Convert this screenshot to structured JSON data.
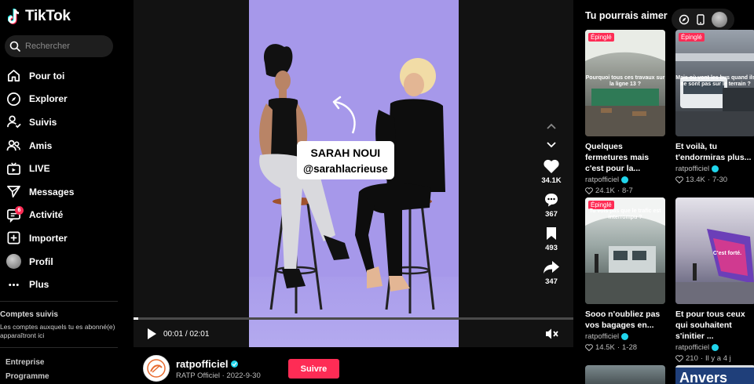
{
  "app": {
    "logo_text": "TikTok"
  },
  "search": {
    "placeholder": "Rechercher"
  },
  "nav": [
    {
      "label": "Pour toi",
      "icon": "home-icon"
    },
    {
      "label": "Explorer",
      "icon": "compass-icon"
    },
    {
      "label": "Suivis",
      "icon": "user-follow-icon"
    },
    {
      "label": "Amis",
      "icon": "friends-icon"
    },
    {
      "label": "LIVE",
      "icon": "live-tv-icon"
    },
    {
      "label": "Messages",
      "icon": "send-icon"
    },
    {
      "label": "Activité",
      "icon": "inbox-icon",
      "badge": "6"
    },
    {
      "label": "Importer",
      "icon": "upload-plus-icon"
    },
    {
      "label": "Profil",
      "icon": "avatar"
    },
    {
      "label": "Plus",
      "icon": "more-dots-icon"
    }
  ],
  "followed": {
    "title": "Comptes suivis",
    "text": "Les comptes auxquels tu es abonné(e) apparaîtront ici"
  },
  "footer_links": [
    "Entreprise",
    "Programme"
  ],
  "video": {
    "name_card_line1": "SARAH NOUI",
    "name_card_line2": "@sarahlacrieuse",
    "likes": "34.1K",
    "comments": "367",
    "saves": "493",
    "shares": "347",
    "time_current": "00:01",
    "time_separator": "/",
    "time_total": "02:01",
    "progress": 0.01
  },
  "account": {
    "name": "ratpofficiel",
    "display_name": "RATP Officiel",
    "separator": "·",
    "date": "2022-9-30",
    "follow_label": "Suivre"
  },
  "reco": {
    "title": "Tu pourrais aimer",
    "cards": [
      {
        "pinned": "Épinglé",
        "caption": "Pourquoi tous ces travaux sur la ligne 13 ?",
        "title": "Quelques fermetures mais c'est pour la...",
        "author": "ratpofficiel",
        "likes": "24.1K",
        "date": "8-7",
        "colors": [
          "#6b6d66",
          "#9a9a8e"
        ]
      },
      {
        "pinned": "Épinglé",
        "caption": "Mais où vont les bus quand ils ne sont pas sur le terrain ?",
        "title": "Et voilà, tu t'endormiras plus...",
        "author": "ratpofficiel",
        "likes": "13.4K",
        "date": "7-30",
        "colors": [
          "#3f4650",
          "#8a9098"
        ]
      },
      {
        "pinned": "Épinglé",
        "caption": "Tu vois pas que le trafic est interrompu ?",
        "title": "Sooo n'oubliez pas vos bagages en...",
        "author": "ratpofficiel",
        "likes": "14.5K",
        "date": "1-28",
        "colors": [
          "#2f3a3c",
          "#8c9a98"
        ]
      },
      {
        "pinned": "",
        "caption": "C'est forté.",
        "title": "Et pour tous ceux qui souhaitent s'initier ...",
        "author": "ratpofficiel",
        "likes": "210",
        "date": "Il y a 4 j",
        "colors": [
          "#4a4c63",
          "#b7b3c9"
        ]
      }
    ]
  },
  "bottom_strip": {
    "sign_text": "Anvers"
  },
  "colors": {
    "accent": "#fe2c55",
    "verified": "#20d5ec",
    "video_bg": "#a698ea"
  }
}
